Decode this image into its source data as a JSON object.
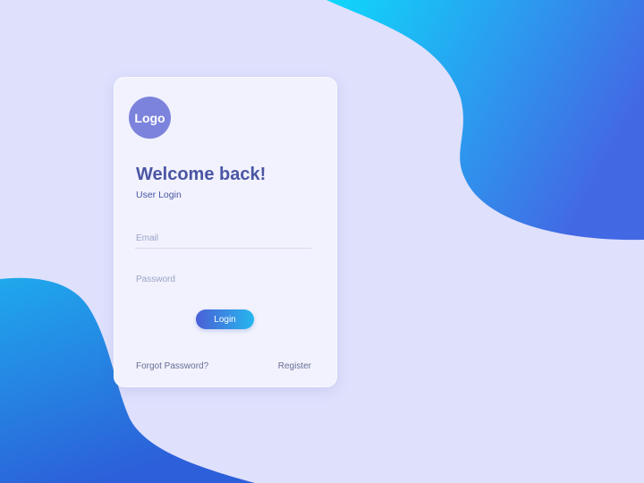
{
  "colors": {
    "background": "#dfe0fc",
    "card": "#f1f2fd",
    "accent": "#4a56a4",
    "logo": "#7c83dc",
    "button_start": "#4a60d6",
    "button_end": "#26b6ee"
  },
  "logo": {
    "label": "Logo"
  },
  "heading": {
    "title": "Welcome back!",
    "subtitle": "User Login"
  },
  "form": {
    "email_placeholder": "Email",
    "email_value": "",
    "password_placeholder": "Password",
    "password_value": "",
    "login_label": "Login"
  },
  "links": {
    "forgot_label": "Forgot Password?",
    "register_label": "Register"
  }
}
